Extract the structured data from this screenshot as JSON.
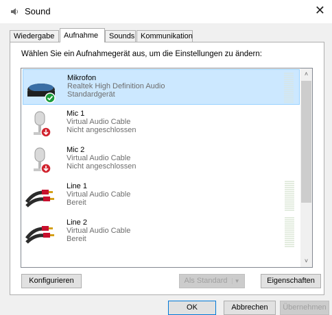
{
  "window": {
    "title": "Sound",
    "close_glyph": "✕"
  },
  "tabs": [
    {
      "label": "Wiedergabe",
      "active": false
    },
    {
      "label": "Aufnahme",
      "active": true
    },
    {
      "label": "Sounds",
      "active": false
    },
    {
      "label": "Kommunikation",
      "active": false
    }
  ],
  "instruction": "Wählen Sie ein Aufnahmegerät aus, um die Einstellungen zu ändern:",
  "devices": [
    {
      "name": "Mikrofon",
      "driver": "Realtek High Definition Audio",
      "status": "Standardgerät",
      "icon": "headset-microphone-icon",
      "badge": "default-check-badge-icon",
      "selected": true,
      "meter": true
    },
    {
      "name": "Mic 1",
      "driver": "Virtual Audio Cable",
      "status": "Nicht angeschlossen",
      "icon": "microphone-icon",
      "badge": "disconnected-arrow-badge-icon",
      "selected": false,
      "meter": false
    },
    {
      "name": "Mic 2",
      "driver": "Virtual Audio Cable",
      "status": "Nicht angeschlossen",
      "icon": "microphone-icon",
      "badge": "disconnected-arrow-badge-icon",
      "selected": false,
      "meter": false
    },
    {
      "name": "Line 1",
      "driver": "Virtual Audio Cable",
      "status": "Bereit",
      "icon": "line-in-cable-icon",
      "selected": false,
      "meter": true
    },
    {
      "name": "Line 2",
      "driver": "Virtual Audio Cable",
      "status": "Bereit",
      "icon": "line-in-cable-icon",
      "selected": false,
      "meter": true
    }
  ],
  "scrollbar": {
    "up_glyph": "˄",
    "down_glyph": "˅"
  },
  "buttons": {
    "configure": "Konfigurieren",
    "set_default": "Als Standard",
    "set_default_arrow": "▼",
    "properties": "Eigenschaften",
    "ok": "OK",
    "cancel": "Abbrechen",
    "apply": "Übernehmen"
  },
  "colors": {
    "selection": "#cce8ff",
    "selection_border": "#99d1ff",
    "accent": "#0078d7",
    "success_badge": "#1a9b3a",
    "error_badge": "#d1242f"
  }
}
